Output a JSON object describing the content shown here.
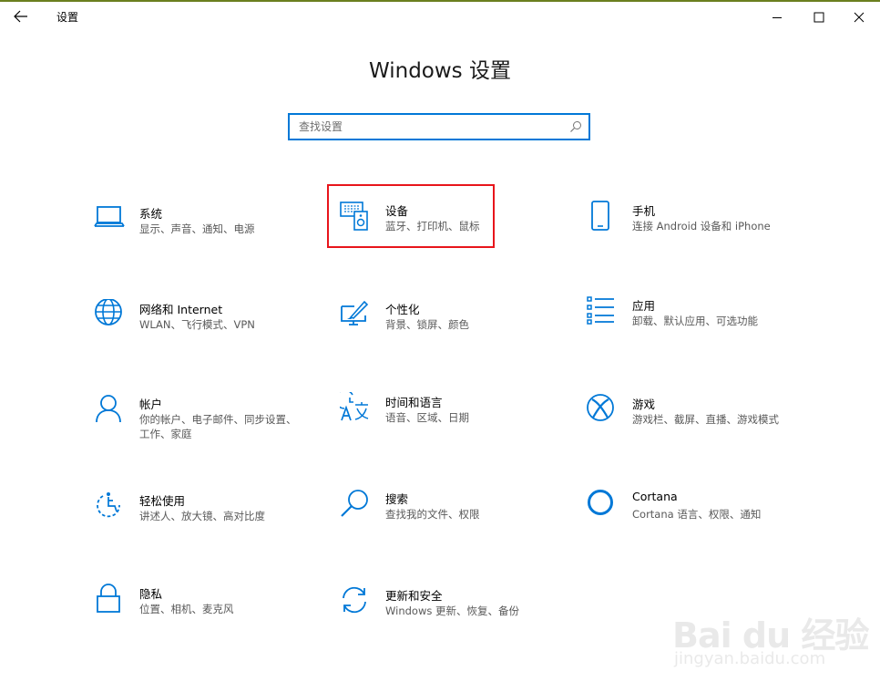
{
  "window": {
    "title": "设置",
    "back_icon": "arrow-left-icon",
    "controls": [
      "minimize-icon",
      "maximize-icon",
      "close-icon"
    ]
  },
  "heading": "Windows 设置",
  "search": {
    "placeholder": "查找设置",
    "value": "",
    "icon": "search-icon"
  },
  "tiles": [
    {
      "title": "系统",
      "desc": "显示、声音、通知、电源",
      "icon": "laptop-icon"
    },
    {
      "title": "设备",
      "desc": "蓝牙、打印机、鼠标",
      "icon": "keyboard-speaker-icon"
    },
    {
      "title": "手机",
      "desc": "连接 Android 设备和 iPhone",
      "icon": "phone-icon"
    },
    {
      "title": "网络和 Internet",
      "desc": "WLAN、飞行模式、VPN",
      "icon": "globe-icon"
    },
    {
      "title": "个性化",
      "desc": "背景、锁屏、颜色",
      "icon": "paintbrush-icon"
    },
    {
      "title": "应用",
      "desc": "卸载、默认应用、可选功能",
      "icon": "app-list-icon"
    },
    {
      "title": "帐户",
      "desc": "你的帐户、电子邮件、同步设置、工作、家庭",
      "icon": "person-icon"
    },
    {
      "title": "时间和语言",
      "desc": "语音、区域、日期",
      "icon": "time-language-icon"
    },
    {
      "title": "游戏",
      "desc": "游戏栏、截屏、直播、游戏模式",
      "icon": "xbox-icon"
    },
    {
      "title": "轻松使用",
      "desc": "讲述人、放大镜、高对比度",
      "icon": "ease-of-access-icon"
    },
    {
      "title": "搜索",
      "desc": "查找我的文件、权限",
      "icon": "search-icon"
    },
    {
      "title": "Cortana",
      "desc": "Cortana 语言、权限、通知",
      "icon": "cortana-icon"
    },
    {
      "title": "隐私",
      "desc": "位置、相机、麦克风",
      "icon": "lock-icon"
    },
    {
      "title": "更新和安全",
      "desc": "Windows 更新、恢复、备份",
      "icon": "sync-icon"
    }
  ],
  "highlight_target": "设备",
  "watermark": {
    "logo": "Bai du 经验",
    "url": "jingyan.baidu.com"
  },
  "colors": {
    "accent": "#0078d7",
    "highlight": "#e8151b"
  }
}
